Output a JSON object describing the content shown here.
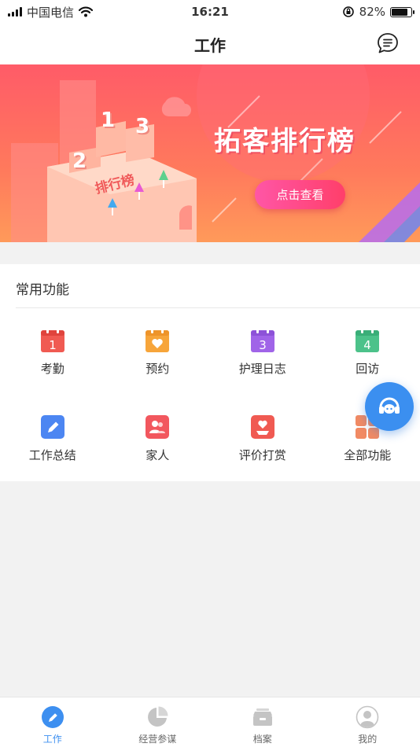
{
  "status_bar": {
    "carrier": "中国电信",
    "time": "16:21",
    "battery": "82%",
    "battery_level": 0.82
  },
  "nav": {
    "title": "工作"
  },
  "banner": {
    "title": "拓客排行榜",
    "button": "点击查看",
    "podium_label": "排行榜",
    "podium_numbers": [
      "1",
      "2",
      "3"
    ]
  },
  "section": {
    "title": "常用功能"
  },
  "features": [
    {
      "label": "考勤",
      "icon": "calendar-1-icon",
      "color": "#f05a52"
    },
    {
      "label": "预约",
      "icon": "calendar-heart-icon",
      "color": "#f7a53a"
    },
    {
      "label": "护理日志",
      "icon": "calendar-3-icon",
      "color": "#a064e8"
    },
    {
      "label": "回访",
      "icon": "calendar-4-icon",
      "color": "#4cc28a"
    },
    {
      "label": "工作总结",
      "icon": "pencil-icon",
      "color": "#4c86f2"
    },
    {
      "label": "家人",
      "icon": "family-icon",
      "color": "#f2575e"
    },
    {
      "label": "评价打赏",
      "icon": "reward-icon",
      "color": "#f05a52"
    },
    {
      "label": "全部功能",
      "icon": "grid-icon",
      "color": "#f18a63"
    }
  ],
  "tabs": [
    {
      "label": "工作",
      "icon": "pencil-circle-icon",
      "active": true
    },
    {
      "label": "经营参谋",
      "icon": "pie-chart-icon",
      "active": false
    },
    {
      "label": "档案",
      "icon": "archive-box-icon",
      "active": false
    },
    {
      "label": "我的",
      "icon": "user-icon",
      "active": false
    }
  ]
}
